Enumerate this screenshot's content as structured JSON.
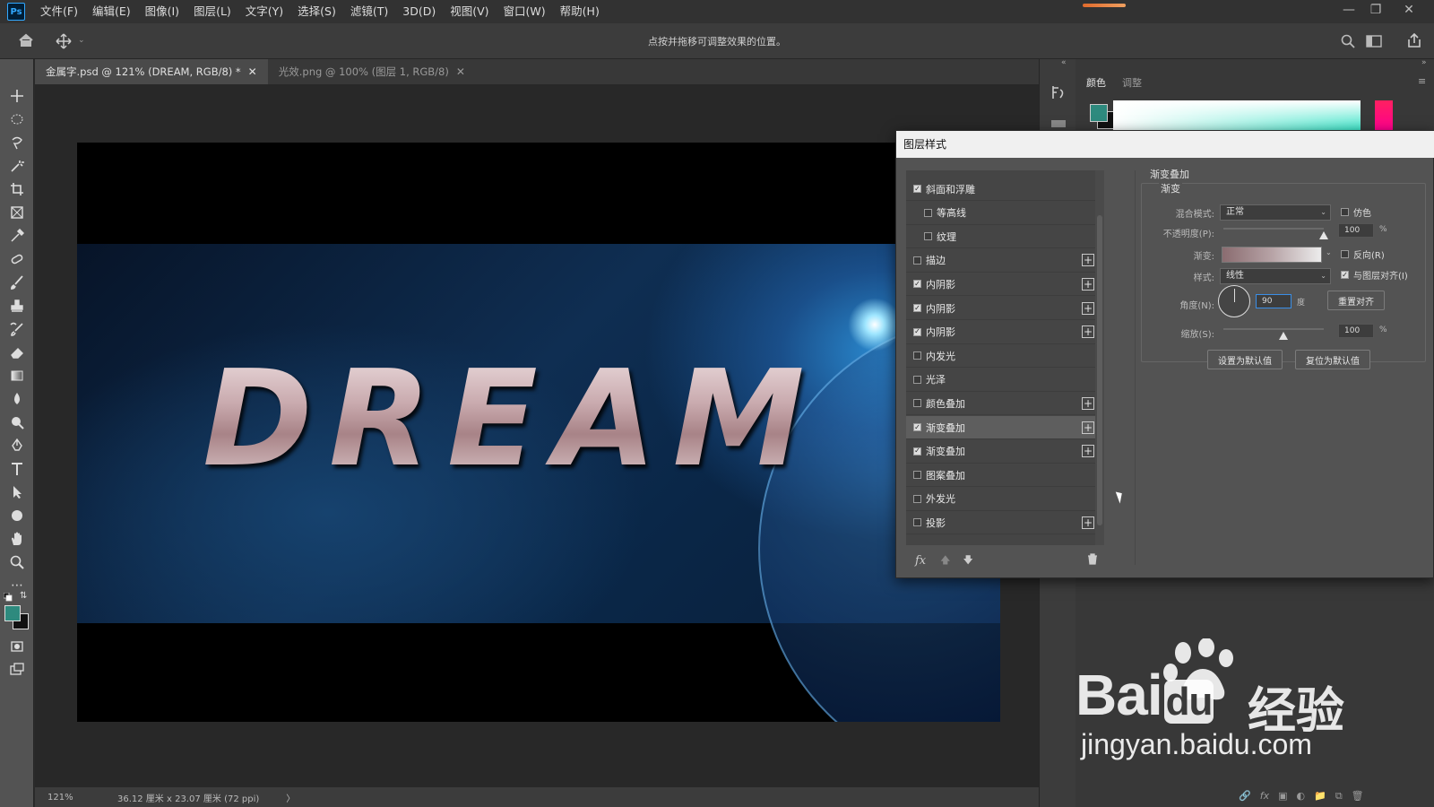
{
  "app": {
    "logo": "Ps"
  },
  "menu": [
    "文件(F)",
    "编辑(E)",
    "图像(I)",
    "图层(L)",
    "文字(Y)",
    "选择(S)",
    "滤镜(T)",
    "3D(D)",
    "视图(V)",
    "窗口(W)",
    "帮助(H)"
  ],
  "options_bar": {
    "hint": "点按并拖移可调整效果的位置。"
  },
  "tabs": [
    {
      "label": "金属字.psd @ 121% (DREAM, RGB/8) *",
      "active": true
    },
    {
      "label": "光效.png @ 100% (图层 1, RGB/8)",
      "active": false
    }
  ],
  "canvas": {
    "text": "DREAM"
  },
  "status": {
    "zoom": "121%",
    "doc_size": "36.12 厘米 x 23.07 厘米 (72 ppi)",
    "arrow": "〉"
  },
  "right_panel": {
    "tab_color": "颜色",
    "tab_adjust": "调整",
    "fg_color": "#2e8a7e",
    "bg_color": "#111111"
  },
  "dialog": {
    "title": "图层样式",
    "styles": [
      {
        "label": "斜面和浮雕",
        "checked": true,
        "sub": false,
        "plus": false
      },
      {
        "label": "等高线",
        "checked": false,
        "sub": true,
        "plus": false
      },
      {
        "label": "纹理",
        "checked": false,
        "sub": true,
        "plus": false
      },
      {
        "label": "描边",
        "checked": false,
        "sub": false,
        "plus": true
      },
      {
        "label": "内阴影",
        "checked": true,
        "sub": false,
        "plus": true
      },
      {
        "label": "内阴影",
        "checked": true,
        "sub": false,
        "plus": true
      },
      {
        "label": "内阴影",
        "checked": true,
        "sub": false,
        "plus": true
      },
      {
        "label": "内发光",
        "checked": false,
        "sub": false,
        "plus": false
      },
      {
        "label": "光泽",
        "checked": false,
        "sub": false,
        "plus": false
      },
      {
        "label": "颜色叠加",
        "checked": false,
        "sub": false,
        "plus": true
      },
      {
        "label": "渐变叠加",
        "checked": true,
        "sub": false,
        "plus": true,
        "selected": true
      },
      {
        "label": "渐变叠加",
        "checked": true,
        "sub": false,
        "plus": true
      },
      {
        "label": "图案叠加",
        "checked": false,
        "sub": false,
        "plus": false
      },
      {
        "label": "外发光",
        "checked": false,
        "sub": false,
        "plus": false
      },
      {
        "label": "投影",
        "checked": false,
        "sub": false,
        "plus": true
      }
    ],
    "fx_label": "fx",
    "section_title": "渐变叠加",
    "group_title": "渐变",
    "blend_mode_label": "混合模式:",
    "blend_mode_value": "正常",
    "dither_label": "仿色",
    "opacity_label": "不透明度(P):",
    "opacity_value": "100",
    "opacity_unit": "%",
    "gradient_label": "渐变:",
    "reverse_label": "反向(R)",
    "style_label": "样式:",
    "style_value": "线性",
    "align_label": "与图层对齐(I)",
    "angle_label": "角度(N):",
    "angle_value": "90",
    "angle_unit": "度",
    "reset_align_button": "重置对齐",
    "scale_label": "缩放(S):",
    "scale_value": "100",
    "scale_unit": "%",
    "set_default_button": "设置为默认值",
    "reset_default_button": "复位为默认值",
    "opacity_fraction": 1.0,
    "scale_fraction": 0.6
  },
  "watermark": {
    "brand_left": "Bai",
    "brand_mid": "du",
    "brand_cn": "经验",
    "url": "jingyan.baidu.com"
  }
}
